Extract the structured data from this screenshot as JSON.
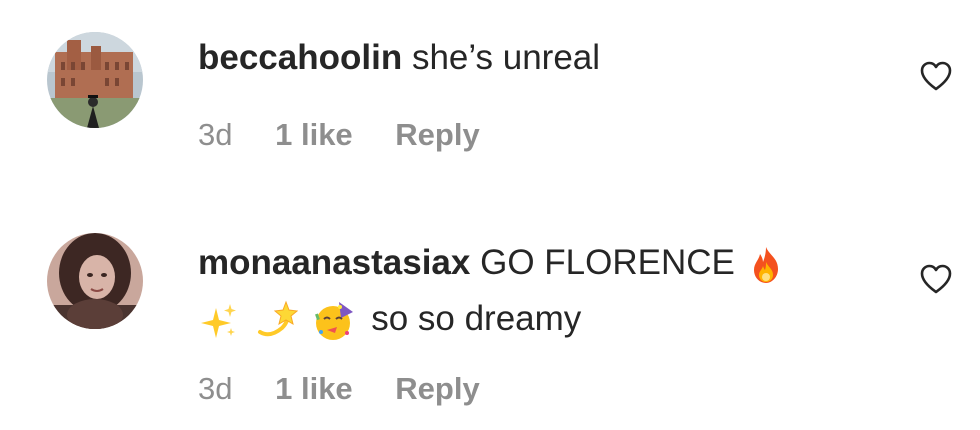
{
  "comments": [
    {
      "username": "beccahoolin",
      "text": "she’s unreal",
      "time": "3d",
      "likes": "1 like",
      "reply": "Reply",
      "avatar_icon": "avatar-university-building"
    },
    {
      "username": "monaanastasiax",
      "text_before_fire": "GO FLORENCE",
      "text_after_emojis": "so so dreamy",
      "emojis": [
        "fire",
        "sparkles",
        "dizzy",
        "partying-face"
      ],
      "time": "3d",
      "likes": "1 like",
      "reply": "Reply",
      "avatar_icon": "avatar-portrait"
    }
  ],
  "icons": {
    "like": "heart-outline-icon"
  },
  "colors": {
    "text": "#262626",
    "meta": "#8e8e8e",
    "background": "#ffffff"
  }
}
